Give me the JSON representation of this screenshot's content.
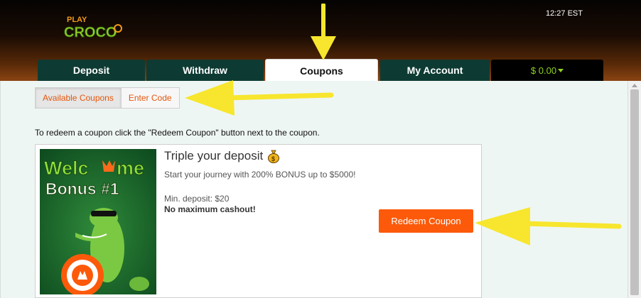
{
  "header": {
    "logo_top": "PLAY",
    "logo_main": "CROCO",
    "time": "12:27 EST"
  },
  "tabs": [
    {
      "label": "Deposit"
    },
    {
      "label": "Withdraw"
    },
    {
      "label": "Coupons"
    },
    {
      "label": "My Account"
    },
    {
      "label": "$ 0.00"
    }
  ],
  "subtabs": [
    {
      "label": "Available Coupons"
    },
    {
      "label": "Enter Code"
    }
  ],
  "instruction": "To redeem a coupon click the \"Redeem Coupon\" button next to the coupon.",
  "coupon": {
    "image_line1": "Welc",
    "image_line1b": "me",
    "image_line2": "Bonus #1",
    "title": "Triple your deposit",
    "description": "Start your journey with 200% BONUS up to $5000!",
    "min_deposit": "Min. deposit: $20",
    "cashout": "No maximum cashout!",
    "button": "Redeem Coupon"
  },
  "colors": {
    "accent": "#fc5a0a",
    "tab_bg": "#0d3b33",
    "balance": "#8fd11f",
    "arrow": "#f7e62d"
  }
}
